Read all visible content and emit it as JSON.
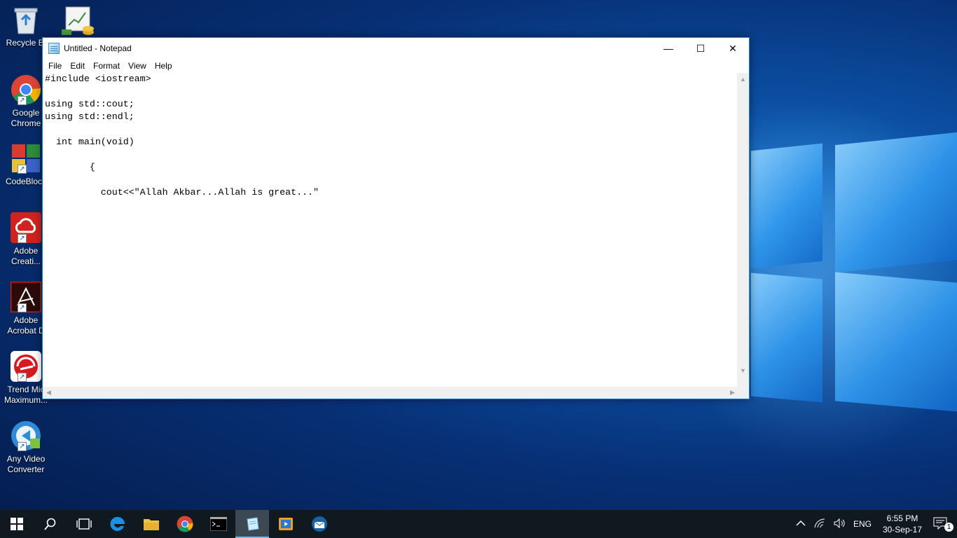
{
  "window": {
    "title": "Untitled - Notepad",
    "minimize_glyph": "—",
    "maximize_glyph": "☐",
    "close_glyph": "✕"
  },
  "menu": [
    "File",
    "Edit",
    "Format",
    "View",
    "Help"
  ],
  "editor": {
    "content": "#include <iostream>\n\nusing std::cout;\nusing std::endl;\n\n  int main(void)\n\n        {\n\n          cout<<\"Allah Akbar...Allah is great...\""
  },
  "desktop_icons": [
    {
      "label": "Recycle Bi",
      "icon": "recycle-bin-icon"
    },
    {
      "label": "Google Chrome",
      "icon": "chrome-icon"
    },
    {
      "label": "CodeBlock",
      "icon": "codeblocks-icon"
    },
    {
      "label": "Adobe Creati...",
      "icon": "adobe-creative-cloud-icon"
    },
    {
      "label": "Adobe Acrobat D",
      "icon": "adobe-acrobat-icon"
    },
    {
      "label": "Trend Mic Maximum...",
      "icon": "trend-micro-icon"
    },
    {
      "label": "Any Video Converter",
      "icon": "any-video-converter-icon"
    }
  ],
  "taskbar": {
    "language": "ENG",
    "time": "6:55 PM",
    "date": "30-Sep-17",
    "notification_count": "1"
  },
  "colors": {
    "accent": "#1883d7",
    "taskbar_bg": "#101820"
  }
}
